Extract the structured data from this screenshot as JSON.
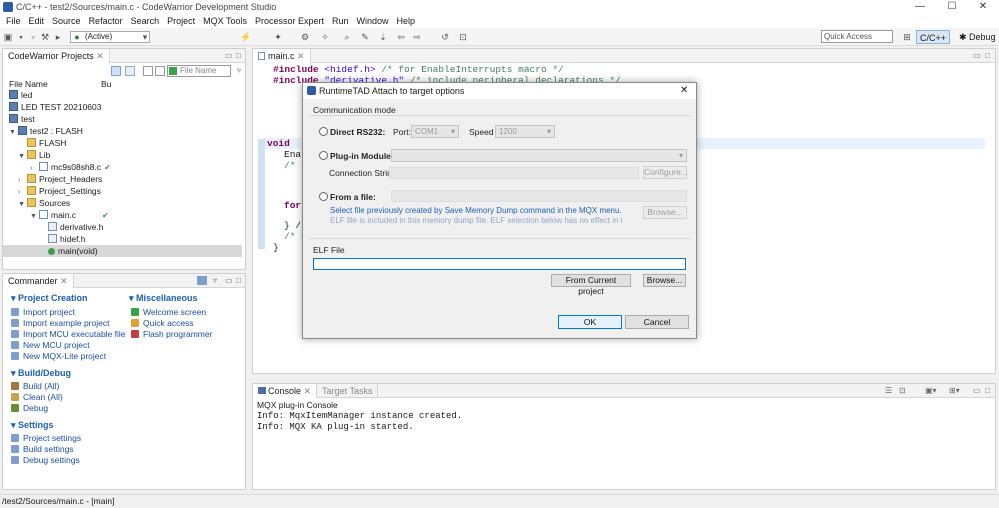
{
  "window": {
    "title": "C/C++ - test2/Sources/main.c - CodeWarrior Development Studio",
    "minimize": "—",
    "maximize": "☐",
    "close": "✕"
  },
  "menubar": [
    "File",
    "Edit",
    "Source",
    "Refactor",
    "Search",
    "Project",
    "MQX Tools",
    "Processor Expert",
    "Run",
    "Window",
    "Help"
  ],
  "toolbar": {
    "active_combo": "(Active)",
    "quick_access_placeholder": "Quick Access",
    "perspective_c": "C/C++",
    "perspective_debug": "Debug"
  },
  "projects_view": {
    "tab": "CodeWarrior Projects",
    "filter_placeholder": "File Name",
    "col_file": "File Name",
    "col_bu": "Bu",
    "items": [
      {
        "label": "led"
      },
      {
        "label": "LED TEST 20210603"
      },
      {
        "label": "test"
      },
      {
        "label": "test2  : FLASH"
      },
      {
        "label": "FLASH"
      },
      {
        "label": "Lib"
      },
      {
        "label": "mc9s08sh8.c"
      },
      {
        "label": "Project_Headers"
      },
      {
        "label": "Project_Settings"
      },
      {
        "label": "Sources"
      },
      {
        "label": "main.c"
      },
      {
        "label": "derivative.h"
      },
      {
        "label": "hidef.h"
      },
      {
        "label": "main(void)"
      }
    ]
  },
  "commander": {
    "tab": "Commander",
    "project_creation": {
      "title": "Project Creation",
      "items": [
        "Import project",
        "Import example project",
        "Import MCU executable file",
        "New MCU project",
        "New MQX-Lite project"
      ]
    },
    "miscellaneous": {
      "title": "Miscellaneous",
      "items": [
        "Welcome screen",
        "Quick access",
        "Flash programmer"
      ]
    },
    "build_debug": {
      "title": "Build/Debug",
      "items": [
        "Build  (All)",
        "Clean  (All)",
        "Debug"
      ]
    },
    "settings": {
      "title": "Settings",
      "items": [
        "Project settings",
        "Build settings",
        "Debug settings"
      ]
    }
  },
  "editor": {
    "tab": "main.c",
    "line1_kw": "#include",
    "line1_inc": " <hidef.h>",
    "line1_cm": " /* for EnableInterrupts macro */",
    "line2_kw": "#include",
    "line2_inc": " \"derivative.h\"",
    "line2_cm": " /* include peripheral declarations */",
    "frag_void": "void",
    "frag_enab": "Enab",
    "frag_slash1": "/* i",
    "frag_for": "for(",
    "frag_close1": "} /*",
    "frag_slash2": "/* P",
    "frag_close2": "}"
  },
  "console": {
    "tab": "Console",
    "tab2": "Target Tasks",
    "heading": "MQX plug-in Console",
    "lines": [
      "Info: MqxItemManager instance created.",
      "Info: MQX KA plug-in started."
    ]
  },
  "dialog": {
    "title": "RuntimeTAD Attach to target options",
    "comm_mode": "Communication mode",
    "direct_rs232": "Direct RS232:",
    "port_label": "Port:",
    "port_value": "COM1",
    "speed_label": "Speed",
    "speed_value": "1200",
    "plugin_module": "Plug-in Module:",
    "connection_string": "Connection String",
    "configure": "Configure...",
    "from_file": "From a file:",
    "browse_disabled": "Browse...",
    "note1": "Select file previously created by Save Memory Dump command in the MQX menu.",
    "note2": "ELF file is included in this memory dump file. ELF selection below has no effect in this",
    "elf_file": "ELF File",
    "from_current": "From Current project",
    "browse": "Browse...",
    "ok": "OK",
    "cancel": "Cancel"
  },
  "status": {
    "path": "/test2/Sources/main.c - [main]"
  }
}
